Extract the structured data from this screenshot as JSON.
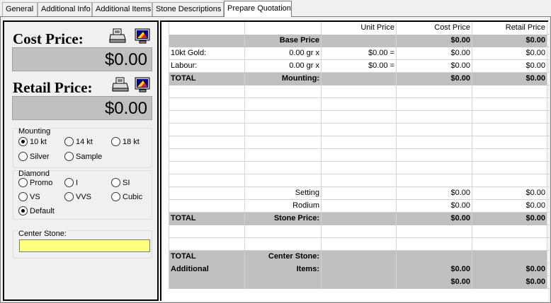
{
  "tabs": [
    {
      "label": "General"
    },
    {
      "label": "Additional Info"
    },
    {
      "label": "Additional Items"
    },
    {
      "label": "Stone Descriptions"
    },
    {
      "label": "Prepare Quotation"
    }
  ],
  "left": {
    "cost_label": "Cost Price:",
    "cost_value": "$0.00",
    "retail_label": "Retail Price:",
    "retail_value": "$0.00",
    "mounting": {
      "title": "Mounting",
      "options": [
        "10 kt",
        "14 kt",
        "18 kt",
        "Silver",
        "Sample"
      ],
      "selected": "10 kt"
    },
    "diamond": {
      "title": "Diamond",
      "options": [
        "Promo",
        "I",
        "SI",
        "VS",
        "VVS",
        "Cubic",
        "Default"
      ],
      "selected": "Default"
    },
    "center_stone": {
      "title": "Center Stone:",
      "value": ""
    }
  },
  "grid": {
    "headers": [
      "",
      "",
      "Unit Price",
      "Cost Price",
      "Retail Price"
    ],
    "rows": [
      {
        "style": "shaded",
        "cells": [
          "",
          "Base Price",
          "",
          "$0.00",
          "$0.00"
        ]
      },
      {
        "style": "plain",
        "cells": [
          "10kt Gold:",
          "0.00 gr x",
          "$0.00 =",
          "$0.00",
          "$0.00"
        ]
      },
      {
        "style": "plain",
        "cells": [
          "Labour:",
          "0.00 gr x",
          "$0.00 =",
          "$0.00",
          "$0.00"
        ]
      },
      {
        "style": "shaded",
        "cells": [
          "TOTAL",
          "Mounting:",
          "",
          "$0.00",
          "$0.00"
        ]
      },
      {
        "style": "plain",
        "cells": [
          "",
          "",
          "",
          "",
          ""
        ]
      },
      {
        "style": "plain",
        "cells": [
          "",
          "",
          "",
          "",
          ""
        ]
      },
      {
        "style": "plain",
        "cells": [
          "",
          "",
          "",
          "",
          ""
        ]
      },
      {
        "style": "plain",
        "cells": [
          "",
          "",
          "",
          "",
          ""
        ]
      },
      {
        "style": "plain",
        "cells": [
          "",
          "",
          "",
          "",
          ""
        ]
      },
      {
        "style": "plain",
        "cells": [
          "",
          "",
          "",
          "",
          ""
        ]
      },
      {
        "style": "plain",
        "cells": [
          "",
          "",
          "",
          "",
          ""
        ]
      },
      {
        "style": "plain",
        "cells": [
          "",
          "",
          "",
          "",
          ""
        ]
      },
      {
        "style": "plain",
        "cells": [
          "",
          "Setting",
          "",
          "$0.00",
          "$0.00"
        ]
      },
      {
        "style": "plain",
        "cells": [
          "",
          "Rodium",
          "",
          "$0.00",
          "$0.00"
        ]
      },
      {
        "style": "shaded",
        "cells": [
          "TOTAL",
          "Stone Price:",
          "",
          "$0.00",
          "$0.00"
        ]
      },
      {
        "style": "plain",
        "cells": [
          "",
          "",
          "",
          "",
          ""
        ]
      },
      {
        "style": "plain",
        "cells": [
          "",
          "",
          "",
          "",
          ""
        ]
      },
      {
        "style": "shaded",
        "cells": [
          "TOTAL",
          "Center Stone:",
          "",
          "",
          ""
        ]
      },
      {
        "style": "shaded",
        "cells": [
          "Additional",
          "Items:",
          "",
          "$0.00",
          "$0.00"
        ]
      },
      {
        "style": "shaded",
        "cells": [
          "",
          "",
          "",
          "$0.00",
          "$0.00"
        ]
      }
    ]
  }
}
